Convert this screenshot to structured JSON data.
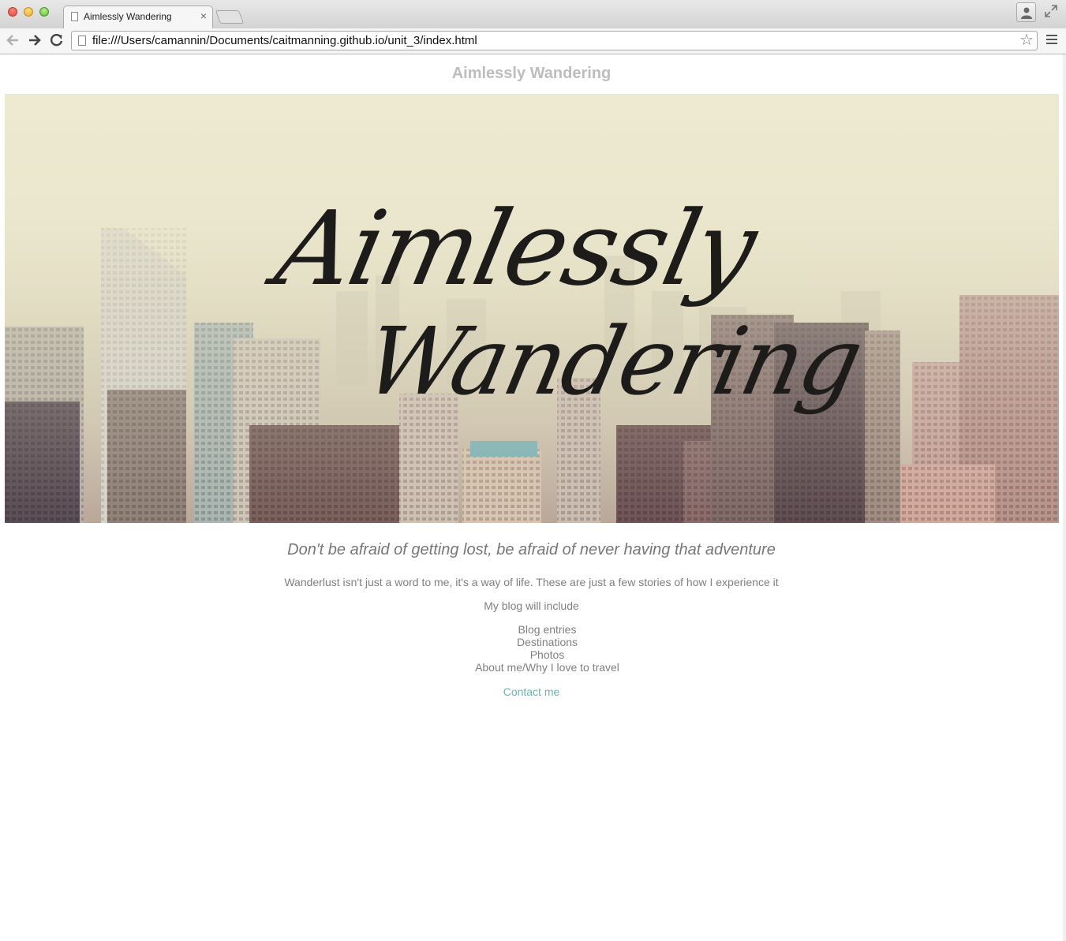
{
  "browser": {
    "tab_title": "Aimlessly Wandering",
    "tab_close": "×",
    "url": "file:///Users/camannin/Documents/caitmanning.github.io/unit_3/index.html"
  },
  "page": {
    "site_title": "Aimlessly Wandering",
    "hero": {
      "line1": "Aimlessly",
      "line2": "Wandering"
    },
    "tagline": "Don't be afraid of getting lost, be afraid of never having that adventure",
    "intro": "Wanderlust isn't just a word to me, it's a way of life. These are just a few stories of how I experience it",
    "blog_include": "My blog will include",
    "blog_items": [
      "Blog entries",
      "Destinations",
      "Photos",
      "About me/Why I love to travel"
    ],
    "contact_label": "Contact me"
  },
  "colors": {
    "site_title": "#bdbdbd",
    "body_text": "#808080",
    "link": "#5fb8b4"
  },
  "icons": [
    "page-icon",
    "close-icon",
    "back-icon",
    "forward-icon",
    "reload-icon",
    "star-icon",
    "menu-icon",
    "profile-icon",
    "fullscreen-icon"
  ]
}
